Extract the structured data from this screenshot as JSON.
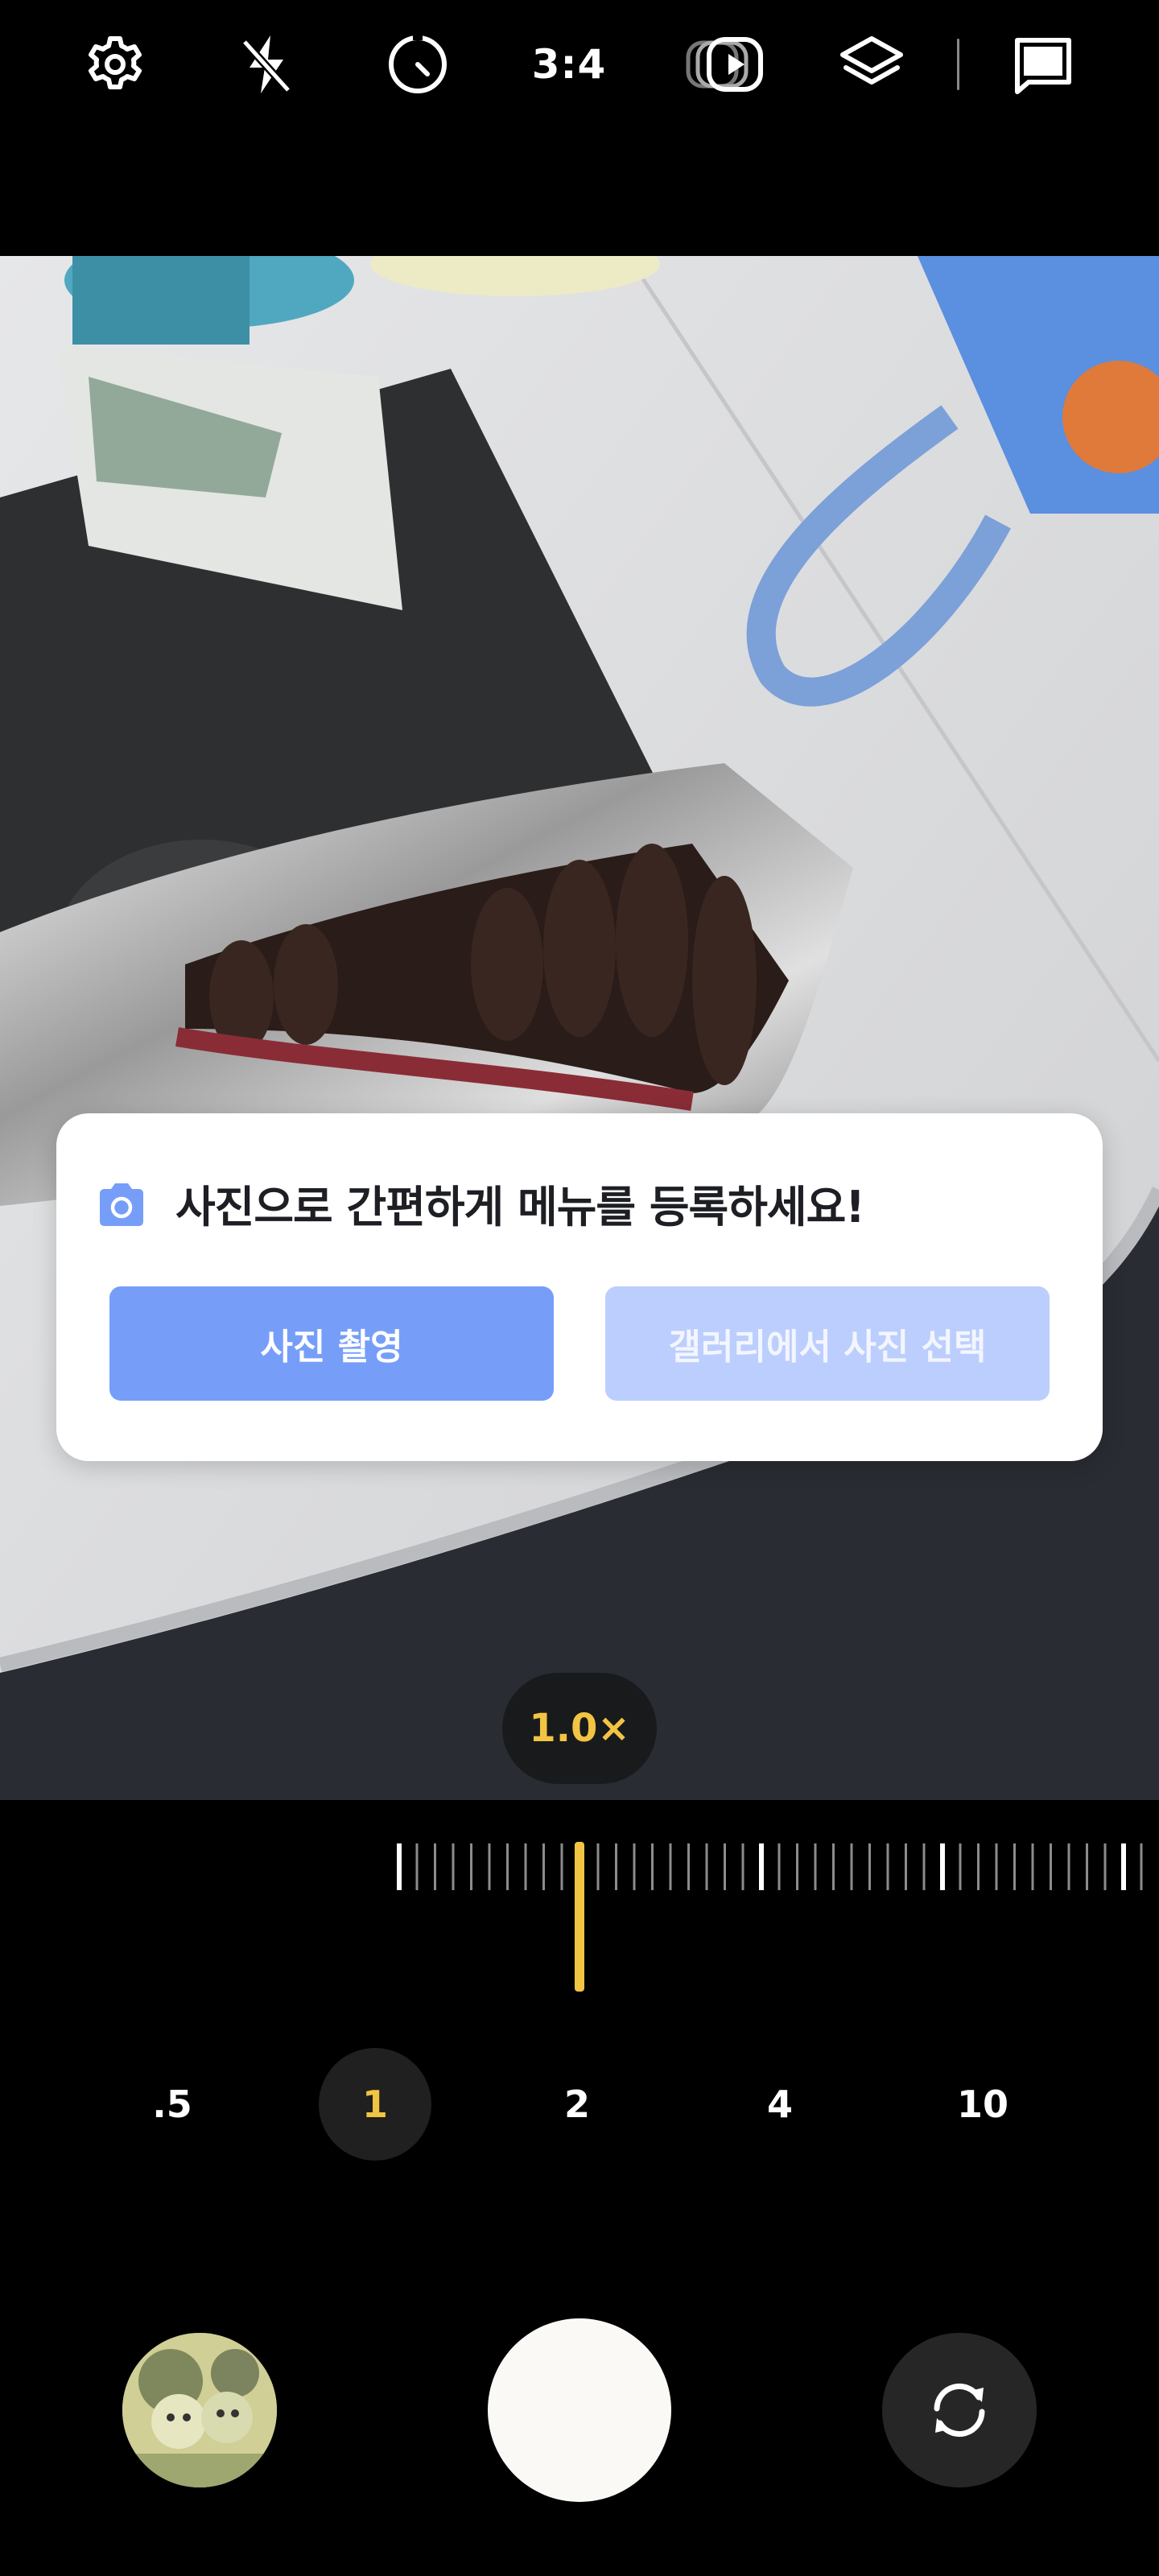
{
  "top_bar": {
    "icons": [
      "gear-icon",
      "flash-off-icon",
      "timer-icon",
      "motion-photo-icon",
      "filters-icon",
      "gallery-icon"
    ],
    "aspect_ratio": "3:4"
  },
  "popup": {
    "icon": "camera-icon",
    "title": "사진으로 간편하게 메뉴를 등록하세요!",
    "primary_button": "사진 촬영",
    "secondary_button": "갤러리에서 사진 선택",
    "colors": {
      "primary": "#769ef9",
      "secondary": "#bccefd"
    }
  },
  "zoom": {
    "current": "1.0×",
    "levels": [
      ".5",
      "1",
      "2",
      "4",
      "10"
    ],
    "selected": "1",
    "accent_color": "#f2c443"
  },
  "bottom": {
    "icons": [
      "gallery-thumbnail",
      "shutter-button",
      "switch-camera-icon"
    ]
  }
}
